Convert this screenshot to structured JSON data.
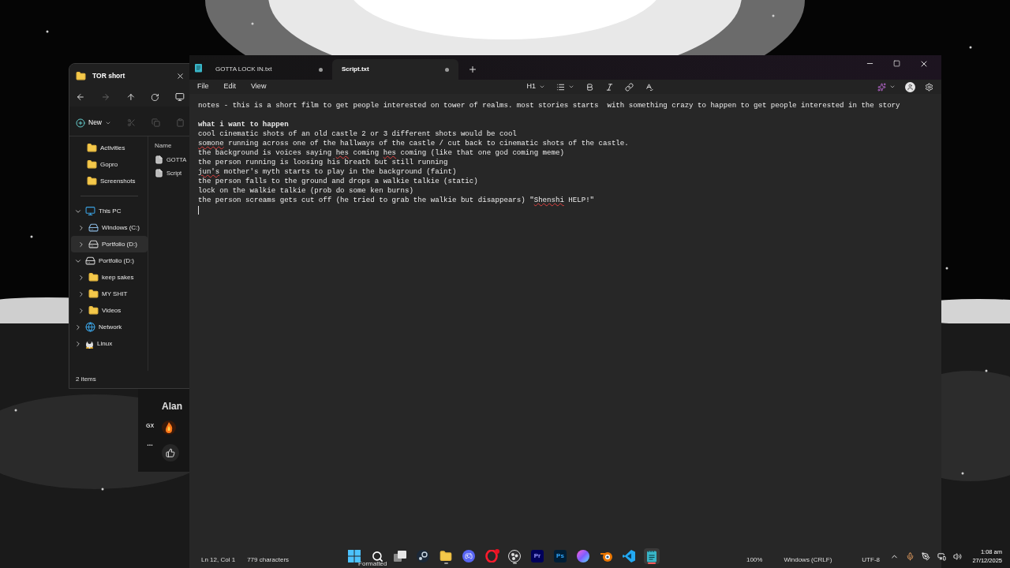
{
  "explorer": {
    "title": "TOR short",
    "new_label": "New",
    "column_header": "Name",
    "files": [
      "GOTTA",
      "Script"
    ],
    "nav": [
      {
        "label": "Activities",
        "kind": "folder",
        "selected": false
      },
      {
        "label": "Gopro",
        "kind": "folder",
        "selected": false
      },
      {
        "label": "Screenshots",
        "kind": "folder",
        "selected": false
      },
      {
        "kind": "separator"
      },
      {
        "label": "This PC",
        "kind": "pc",
        "selected": false,
        "expanded": true,
        "children": [
          {
            "label": "Windows (C:)",
            "kind": "system-drive",
            "selected": false,
            "expanded": false
          },
          {
            "label": "Portfolio (D:)",
            "kind": "drive",
            "selected": true,
            "expanded": false
          }
        ]
      },
      {
        "label": "Portfolio (D:)",
        "kind": "drive",
        "selected": false,
        "expanded": true,
        "children": [
          {
            "label": "keep sakes",
            "kind": "folder",
            "selected": false,
            "expanded": false
          },
          {
            "label": "MY SHIT",
            "kind": "folder",
            "selected": false,
            "expanded": false
          },
          {
            "label": "Videos",
            "kind": "folder",
            "selected": false,
            "expanded": false
          }
        ]
      },
      {
        "label": "Network",
        "kind": "network",
        "selected": false,
        "expanded": false
      },
      {
        "label": "Linux",
        "kind": "linux",
        "selected": false,
        "expanded": false
      }
    ],
    "status": "2 items"
  },
  "browser_sidebar": {
    "name": "Alan",
    "badge": "GX",
    "more": "..."
  },
  "notepad": {
    "tabs": [
      {
        "title": "GOTTA LOCK IN.txt",
        "selected": false,
        "unsaved": true
      },
      {
        "title": "Script.txt",
        "selected": true,
        "unsaved": true
      }
    ],
    "menu": [
      "File",
      "Edit",
      "View"
    ],
    "heading_level": "H1",
    "lines": [
      {
        "kind": "text",
        "segments": [
          {
            "text": "notes - this is a short film to get people interested on tower of realms. most stories starts  with something crazy to happen to get people interested in the story",
            "misspelled": false
          }
        ]
      },
      {
        "kind": "blank",
        "caret": false
      },
      {
        "kind": "heading",
        "segments": [
          {
            "text": "what i want to happen",
            "misspelled": false
          }
        ]
      },
      {
        "kind": "text",
        "segments": [
          {
            "text": "cool cinematic shots of an old castle 2 or 3 different shots would be cool",
            "misspelled": false
          }
        ]
      },
      {
        "kind": "text",
        "segments": [
          {
            "text": "somone",
            "misspelled": true
          },
          {
            "text": " running across one of the hallways of the castle / cut back to cinematic shots of the castle.",
            "misspelled": false
          }
        ]
      },
      {
        "kind": "text",
        "segments": [
          {
            "text": "the background is voices saying ",
            "misspelled": false
          },
          {
            "text": "hes",
            "misspelled": true
          },
          {
            "text": " coming ",
            "misspelled": false
          },
          {
            "text": "hes",
            "misspelled": true
          },
          {
            "text": " coming (like that one god coming meme)",
            "misspelled": false
          }
        ]
      },
      {
        "kind": "text",
        "segments": [
          {
            "text": "the person running is loosing his breath but still running",
            "misspelled": false
          }
        ]
      },
      {
        "kind": "text",
        "segments": [
          {
            "text": "jun's",
            "misspelled": true
          },
          {
            "text": " mother's myth starts to play in the background (faint)",
            "misspelled": false
          }
        ]
      },
      {
        "kind": "text",
        "segments": [
          {
            "text": "the person falls to the ground and drops a walkie talkie (static)",
            "misspelled": false
          }
        ]
      },
      {
        "kind": "text",
        "segments": [
          {
            "text": "lock on the walkie talkie (prob do some ken burns)",
            "misspelled": false
          }
        ]
      },
      {
        "kind": "text",
        "segments": [
          {
            "text": "the person screams gets cut off (he tried to grab the walkie but disappears) \"",
            "misspelled": false
          },
          {
            "text": "Shenshi",
            "misspelled": true
          },
          {
            "text": " HELP!\"",
            "misspelled": false
          }
        ]
      },
      {
        "kind": "blank",
        "caret": true
      }
    ],
    "status_bar": {
      "position": "Ln 12, Col 1",
      "characters": "779 characters",
      "mode": "Formatted",
      "zoom": "100%",
      "line_endings": "Windows (CRLF)",
      "encoding": "UTF-8"
    }
  },
  "taskbar": {
    "apps": [
      {
        "kind": "start",
        "running": false,
        "active": false,
        "notification": false
      },
      {
        "kind": "search",
        "running": false,
        "active": false,
        "notification": false
      },
      {
        "kind": "taskview",
        "running": false,
        "active": false,
        "notification": false
      },
      {
        "kind": "steam",
        "running": false,
        "active": false,
        "notification": false
      },
      {
        "kind": "explorer",
        "running": true,
        "active": false,
        "notification": false
      },
      {
        "kind": "discord",
        "running": false,
        "active": false,
        "notification": false
      },
      {
        "kind": "opera",
        "running": false,
        "active": false,
        "notification": true
      },
      {
        "kind": "obs",
        "running": true,
        "active": false,
        "notification": false
      },
      {
        "kind": "premiere",
        "label": "Pr",
        "running": false,
        "active": false,
        "notification": false
      },
      {
        "kind": "photoshop",
        "label": "Ps",
        "running": false,
        "active": false,
        "notification": false
      },
      {
        "kind": "orb",
        "running": false,
        "active": false,
        "notification": false
      },
      {
        "kind": "blender",
        "running": false,
        "active": false,
        "notification": false
      },
      {
        "kind": "vscode",
        "running": false,
        "active": false,
        "notification": false
      },
      {
        "kind": "notepad",
        "running": true,
        "active": true,
        "notification": false
      }
    ],
    "time": "1:08 am",
    "date": "27/12/2025"
  }
}
